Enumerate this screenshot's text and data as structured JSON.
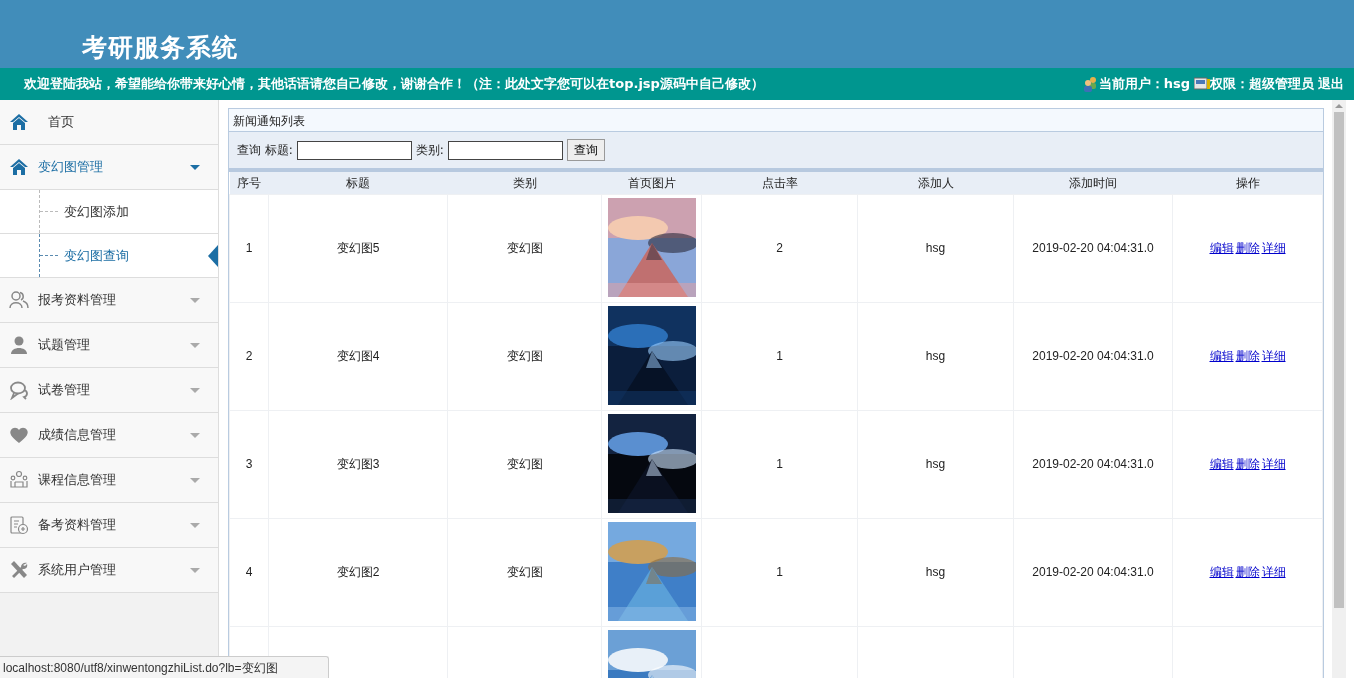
{
  "header": {
    "title": "考研服务系统",
    "welcome": "欢迎登陆我站，希望能给你带来好心情，其他话语请您自己修改，谢谢合作！（注：此处文字您可以在top.jsp源码中自己修改）",
    "current_user": "当前用户：hsg",
    "permission": "权限：超级管理员",
    "logout": "退出"
  },
  "sidebar": {
    "items": [
      {
        "kind": "link",
        "label": "首页",
        "expanded": false
      },
      {
        "kind": "group",
        "label": "变幻图管理",
        "expanded": true,
        "children": [
          {
            "label": "变幻图添加",
            "selected": false
          },
          {
            "label": "变幻图查询",
            "selected": true
          }
        ]
      },
      {
        "kind": "group",
        "label": "报考资料管理",
        "expanded": false
      },
      {
        "kind": "group",
        "label": "试题管理",
        "expanded": false
      },
      {
        "kind": "group",
        "label": "试卷管理",
        "expanded": false
      },
      {
        "kind": "group",
        "label": "成绩信息管理",
        "expanded": false
      },
      {
        "kind": "group",
        "label": "课程信息管理",
        "expanded": false
      },
      {
        "kind": "group",
        "label": "备考资料管理",
        "expanded": false
      },
      {
        "kind": "group",
        "label": "系统用户管理",
        "expanded": false
      }
    ]
  },
  "list_title": "新闻通知列表",
  "search": {
    "prefix": "查询 标题:",
    "category_label": "类别:",
    "button": "查询"
  },
  "table": {
    "columns": [
      "序号",
      "标题",
      "类别",
      "首页图片",
      "点击率",
      "添加人",
      "添加时间",
      "操作"
    ],
    "rows": [
      {
        "no": "1",
        "title": "变幻图5",
        "category": "变幻图",
        "image": {
          "kind": "picture"
        },
        "clicks": "2",
        "user": "hsg",
        "time": "2019-02-20 04:04:31.0",
        "actions": [
          "编辑",
          "删除",
          "详细"
        ]
      },
      {
        "no": "2",
        "title": "变幻图4",
        "category": "变幻图",
        "image": {
          "kind": "picture"
        },
        "clicks": "1",
        "user": "hsg",
        "time": "2019-02-20 04:04:31.0",
        "actions": [
          "编辑",
          "删除",
          "详细"
        ]
      },
      {
        "no": "3",
        "title": "变幻图3",
        "category": "变幻图",
        "image": {
          "kind": "picture"
        },
        "clicks": "1",
        "user": "hsg",
        "time": "2019-02-20 04:04:31.0",
        "actions": [
          "编辑",
          "删除",
          "详细"
        ]
      },
      {
        "no": "4",
        "title": "变幻图2",
        "category": "变幻图",
        "image": {
          "kind": "picture"
        },
        "clicks": "1",
        "user": "hsg",
        "time": "2019-02-20 04:04:31.0",
        "actions": [
          "编辑",
          "删除",
          "详细"
        ]
      },
      {
        "image": {
          "kind": "picture"
        }
      }
    ]
  },
  "status_url": "localhost:8080/utf8/xinwentongzhiList.do?lb=变幻图"
}
